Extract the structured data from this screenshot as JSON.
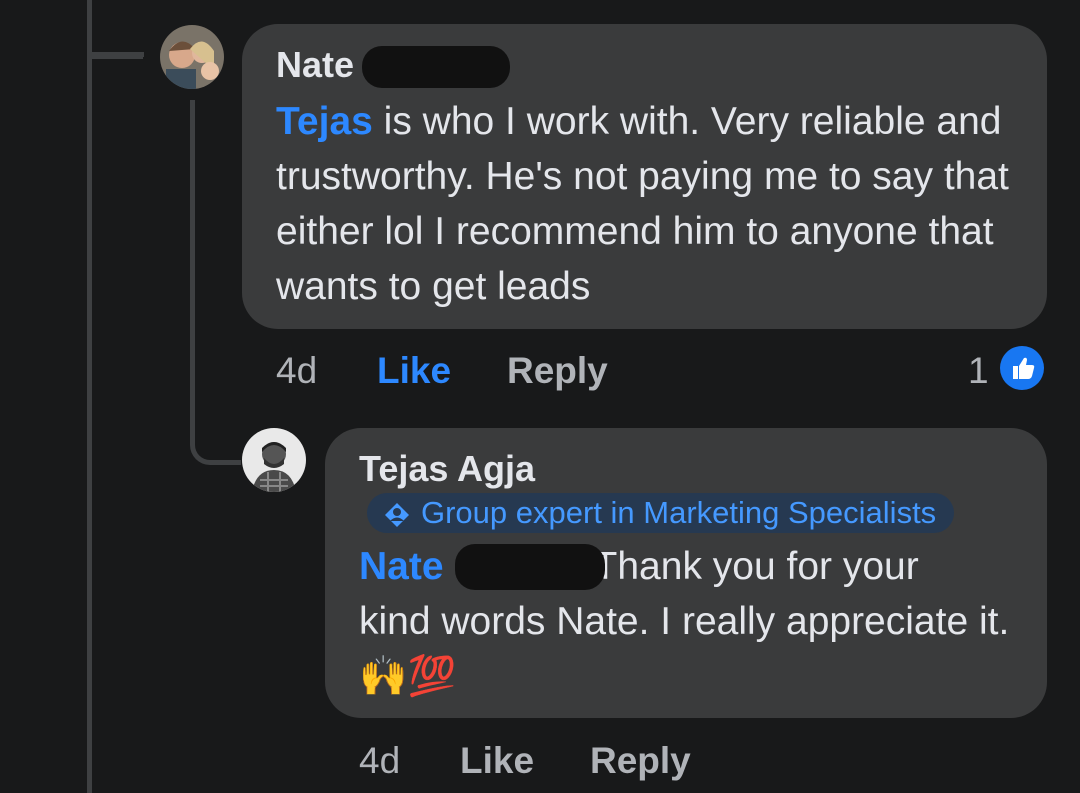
{
  "comments": [
    {
      "author": "Nate",
      "mention": "Tejas",
      "text": " is who I work with. Very reliable and trustworthy. He's not paying me to say that either lol I recommend him to anyone that wants to get leads",
      "time": "4d",
      "like_label": "Like",
      "reply_label": "Reply",
      "reaction_count": "1",
      "reaction_icon": "thumbs-up-icon"
    },
    {
      "author": "Tejas Agja",
      "badge": "Group expert in Marketing Specialists",
      "badge_icon": "expert-badge-icon",
      "mention": "Nate",
      "text_line1": "Thank you for your",
      "text_rest": "kind words Nate. I really appreciate it. 🙌💯",
      "time": "4d",
      "like_label": "Like",
      "reply_label": "Reply"
    }
  ],
  "colors": {
    "background": "#18191a",
    "bubble": "#3a3b3c",
    "mention": "#2d88ff",
    "secondary_text": "#b0b3b8",
    "badge_bg": "#263951"
  }
}
